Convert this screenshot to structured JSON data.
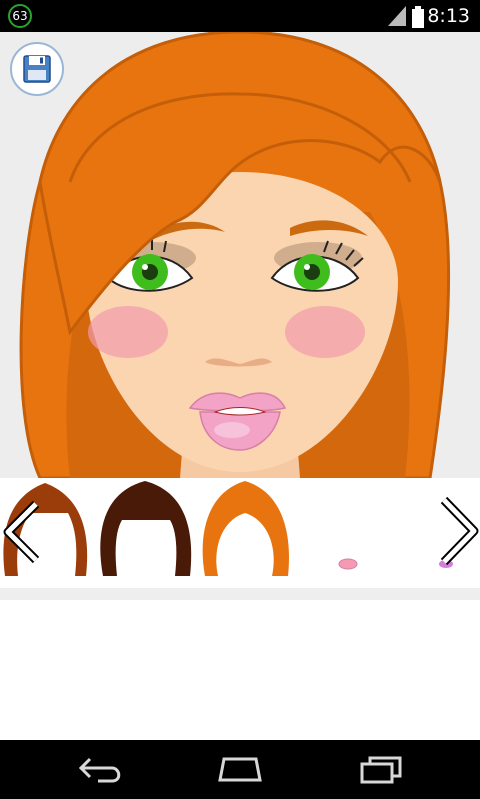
{
  "status_bar": {
    "notification_count": "63",
    "time": "8:13",
    "icons": [
      "notification-badge-icon",
      "signal-icon",
      "battery-icon"
    ]
  },
  "toolbar": {
    "save_icon": "floppy-disk-icon"
  },
  "character": {
    "hair_color": "#e8740f",
    "skin_color": "#fad5b0",
    "eye_color": "#3fbd1c",
    "blush_color": "#f29aac",
    "lip_color": "#f2a3c6"
  },
  "picker": {
    "prev_icon": "chevron-left-icon",
    "next_icon": "chevron-right-icon",
    "items": [
      {
        "kind": "hair",
        "color": "#9b3d0b"
      },
      {
        "kind": "hair",
        "color": "#4a1a08"
      },
      {
        "kind": "hair",
        "color": "#e8740f",
        "selected": true
      },
      {
        "kind": "lips",
        "color": "#f59ab0"
      },
      {
        "kind": "lips",
        "color": "#d67be0"
      }
    ]
  },
  "nav_bar": {
    "icons": [
      "back-icon",
      "home-icon",
      "recent-apps-icon"
    ]
  }
}
